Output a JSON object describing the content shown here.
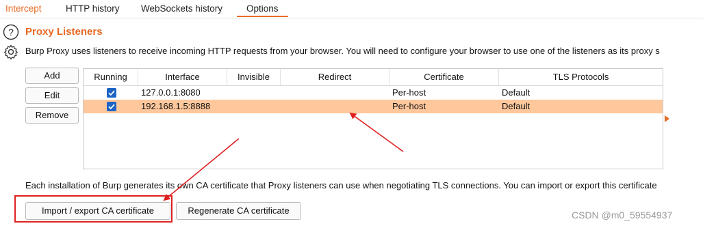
{
  "tabs": [
    {
      "label": "Intercept"
    },
    {
      "label": "HTTP history"
    },
    {
      "label": "WebSockets history"
    },
    {
      "label": "Options"
    }
  ],
  "section": {
    "title": "Proxy Listeners",
    "description": "Burp Proxy uses listeners to receive incoming HTTP requests from your browser. You will need to configure your browser to use one of the listeners as its proxy s"
  },
  "listener_buttons": {
    "add": "Add",
    "edit": "Edit",
    "remove": "Remove"
  },
  "table": {
    "columns": [
      "Running",
      "Interface",
      "Invisible",
      "Redirect",
      "Certificate",
      "TLS Protocols"
    ],
    "rows": [
      {
        "running": true,
        "interface": "127.0.0.1:8080",
        "invisible": "",
        "redirect": "",
        "certificate": "Per-host",
        "tls": "Default"
      },
      {
        "running": true,
        "interface": "192.168.1.5:8888",
        "invisible": "",
        "redirect": "",
        "certificate": "Per-host",
        "tls": "Default"
      }
    ]
  },
  "ca_note": "Each installation of Burp generates its own CA certificate that Proxy listeners can use when negotiating TLS connections. You can import or export this certificate",
  "ca_buttons": {
    "import_export": "Import / export CA certificate",
    "regenerate": "Regenerate CA certificate"
  },
  "watermark": "CSDN @m0_59554937",
  "colors": {
    "accent": "#e86a24",
    "selected_row": "#ffc79c",
    "checkbox": "#1d64c4",
    "annotation": "#e02020"
  }
}
